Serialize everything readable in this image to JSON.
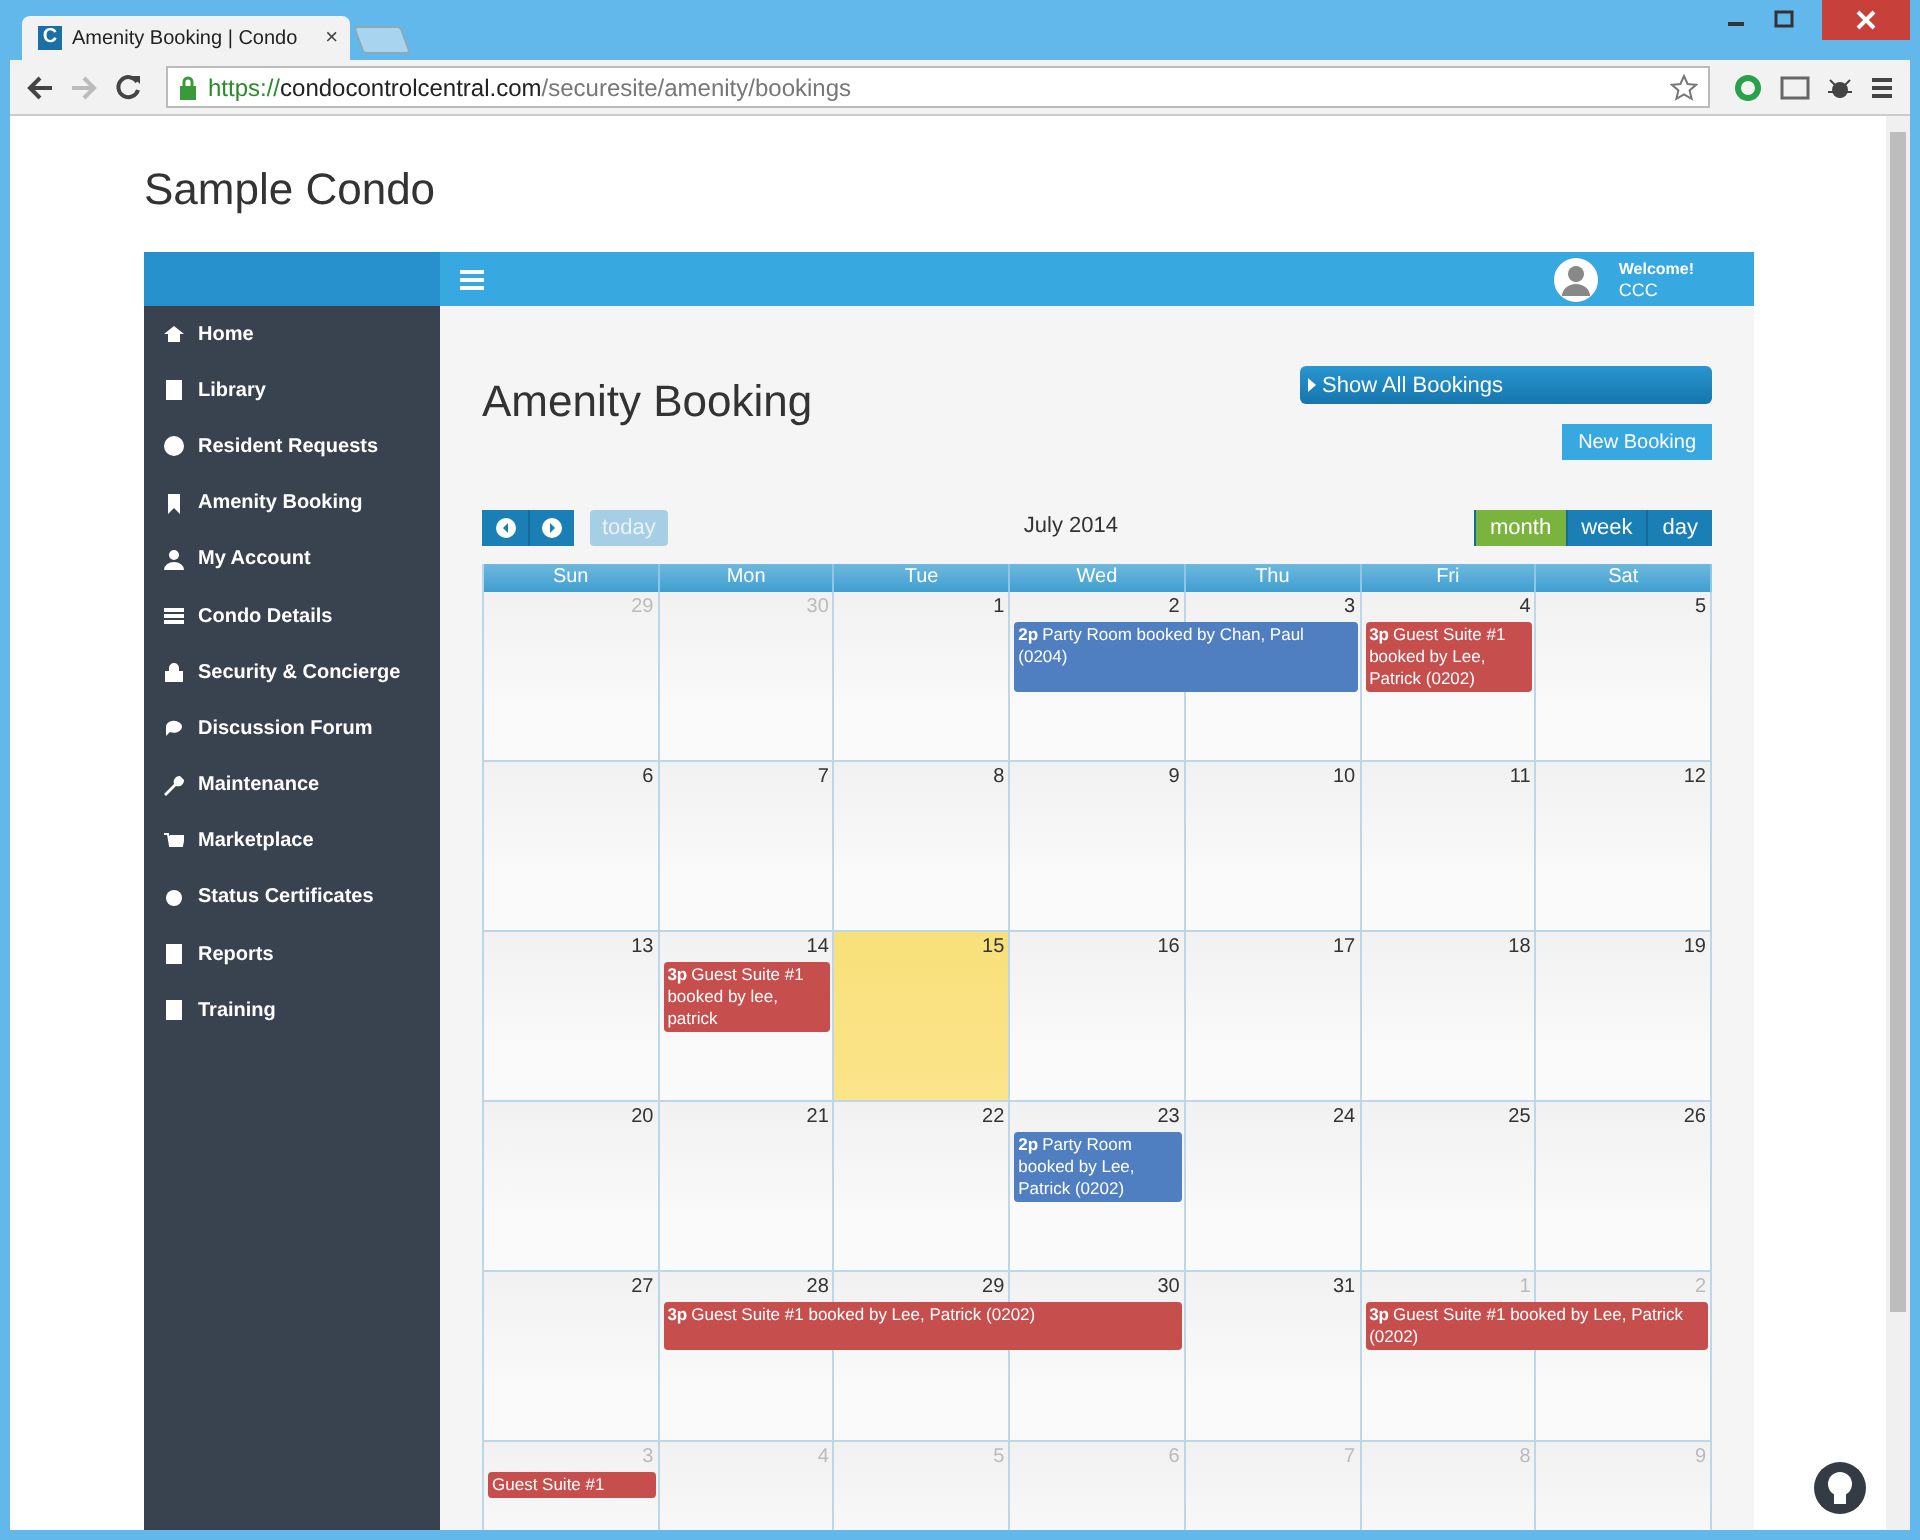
{
  "browser": {
    "tab": {
      "favicon": "C",
      "title": "Amenity Booking | Condo",
      "close": "×"
    },
    "url": {
      "scheme": "https://",
      "host": "condocontrolcentral.com",
      "path": "/securesite/amenity/bookings"
    }
  },
  "site_title": "Sample Condo",
  "header": {
    "welcome": "Welcome!",
    "user": "CCC"
  },
  "sidebar": {
    "items": [
      "Home",
      "Library",
      "Resident Requests",
      "Amenity Booking",
      "My Account",
      "Condo Details",
      "Security & Concierge",
      "Discussion Forum",
      "Maintenance",
      "Marketplace",
      "Status Certificates",
      "Reports",
      "Training"
    ]
  },
  "page_title": "Amenity Booking",
  "show_all_button": "Show All Bookings",
  "new_booking_button": "New Booking",
  "calendar": {
    "today_button": {
      "label": "today",
      "disabled": true
    },
    "title": "July 2014",
    "views": [
      {
        "label": "month",
        "selected": true
      },
      {
        "label": "week",
        "selected": false
      },
      {
        "label": "day",
        "selected": false
      }
    ],
    "weekdays": [
      "Sun",
      "Mon",
      "Tue",
      "Wed",
      "Thu",
      "Fri",
      "Sat"
    ],
    "weeks": [
      {
        "days": [
          {
            "num": "29",
            "other_month": true,
            "today": false,
            "continued": false
          },
          {
            "num": "30",
            "other_month": true,
            "today": false,
            "continued": false
          },
          {
            "num": "1",
            "other_month": false,
            "today": false,
            "continued": false
          },
          {
            "num": "2",
            "other_month": false,
            "today": false,
            "booking": {
              "time": "2p",
              "title": "Party Room booked by Chan, Paul (0204)",
              "color": "#4f7fc0"
            }
          },
          {
            "num": "3",
            "other_month": false,
            "today": false,
            "continued": true
          },
          {
            "num": "4",
            "other_month": false,
            "today": false,
            "booking": {
              "time": "3p",
              "title": "Guest Suite #1 booked by Lee, Patrick (0202)",
              "color": "#c64f4d"
            }
          },
          {
            "num": "5",
            "other_month": false,
            "today": false,
            "continued": false
          }
        ]
      },
      {
        "days": [
          {
            "num": "6",
            "other_month": false,
            "today": false,
            "continued": false
          },
          {
            "num": "7",
            "other_month": false,
            "today": false,
            "continued": false
          },
          {
            "num": "8",
            "other_month": false,
            "today": false,
            "continued": false
          },
          {
            "num": "9",
            "other_month": false,
            "today": false,
            "continued": false
          },
          {
            "num": "10",
            "other_month": false,
            "today": false,
            "continued": false
          },
          {
            "num": "11",
            "other_month": false,
            "today": false,
            "continued": false
          },
          {
            "num": "12",
            "other_month": false,
            "today": false,
            "continued": false
          }
        ]
      },
      {
        "days": [
          {
            "num": "13",
            "other_month": false,
            "today": false,
            "continued": false
          },
          {
            "num": "14",
            "other_month": false,
            "today": false,
            "booking": {
              "time": "3p",
              "title": "Guest Suite #1 booked by lee, patrick",
              "color": "#c64f4d"
            }
          },
          {
            "num": "15",
            "other_month": false,
            "today": true,
            "continued": false
          },
          {
            "num": "16",
            "other_month": false,
            "today": false,
            "continued": false
          },
          {
            "num": "17",
            "other_month": false,
            "today": false,
            "continued": false
          },
          {
            "num": "18",
            "other_month": false,
            "today": false,
            "continued": false
          },
          {
            "num": "19",
            "other_month": false,
            "today": false,
            "continued": false
          }
        ]
      },
      {
        "days": [
          {
            "num": "20",
            "other_month": false,
            "today": false,
            "continued": false
          },
          {
            "num": "21",
            "other_month": false,
            "today": false,
            "continued": false
          },
          {
            "num": "22",
            "other_month": false,
            "today": false,
            "continued": false
          },
          {
            "num": "23",
            "other_month": false,
            "today": false,
            "booking": {
              "time": "2p",
              "title": "Party Room booked by Lee, Patrick (0202)",
              "color": "#4f7fc0"
            }
          },
          {
            "num": "24",
            "other_month": false,
            "today": false,
            "continued": false
          },
          {
            "num": "25",
            "other_month": false,
            "today": false,
            "continued": false
          },
          {
            "num": "26",
            "other_month": false,
            "today": false,
            "continued": false
          }
        ]
      },
      {
        "days": [
          {
            "num": "27",
            "other_month": false,
            "today": false,
            "continued": false
          },
          {
            "num": "28",
            "other_month": false,
            "today": false,
            "booking": {
              "time": "3p",
              "title": "Guest Suite #1 booked by Lee, Patrick (0202)",
              "color": "#c64f4d"
            }
          },
          {
            "num": "29",
            "other_month": false,
            "today": false,
            "continued": true
          },
          {
            "num": "30",
            "other_month": false,
            "today": false,
            "continued": true
          },
          {
            "num": "31",
            "other_month": false,
            "today": false,
            "continued": false
          },
          {
            "num": "1",
            "other_month": true,
            "today": false,
            "booking": {
              "time": "3p",
              "title": "Guest Suite #1 booked by Lee, Patrick (0202)",
              "color": "#c64f4d"
            }
          },
          {
            "num": "2",
            "other_month": true,
            "today": false,
            "continued": true
          }
        ]
      },
      {
        "days": [
          {
            "num": "3",
            "other_month": true,
            "today": false,
            "booking": {
              "title": "Guest Suite #1",
              "color": "#c64f4d"
            }
          },
          {
            "num": "4",
            "other_month": true,
            "today": false,
            "continued": false
          },
          {
            "num": "5",
            "other_month": true,
            "today": false,
            "continued": false
          },
          {
            "num": "6",
            "other_month": true,
            "today": false,
            "continued": false
          },
          {
            "num": "7",
            "other_month": true,
            "today": false,
            "continued": false
          },
          {
            "num": "8",
            "other_month": true,
            "today": false,
            "continued": false
          },
          {
            "num": "9",
            "other_month": true,
            "today": false,
            "continued": false
          }
        ]
      }
    ]
  }
}
